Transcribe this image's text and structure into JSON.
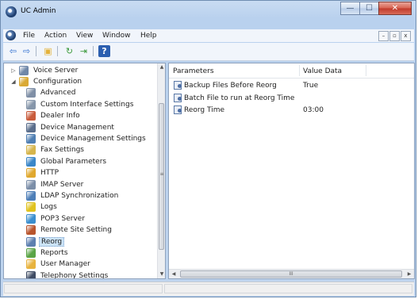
{
  "window": {
    "title": "UC Admin"
  },
  "menu": [
    "File",
    "Action",
    "View",
    "Window",
    "Help"
  ],
  "caption_buttons": {
    "minimize": "—",
    "maximize": "☐",
    "close": "✕"
  },
  "mdi_buttons": {
    "minimize": "–",
    "restore": "▫",
    "close": "x"
  },
  "toolbar": [
    {
      "name": "back-icon",
      "glyph": "⇦",
      "color": "#2f6fd0"
    },
    {
      "name": "forward-icon",
      "glyph": "⇨",
      "color": "#2f6fd0"
    },
    {
      "name": "up-folder-icon",
      "glyph": "▣",
      "color": "#e4b23a"
    },
    {
      "name": "refresh-icon",
      "glyph": "↻",
      "color": "#3c9a3c"
    },
    {
      "name": "export-list-icon",
      "glyph": "⇥",
      "color": "#3c9a3c"
    },
    {
      "name": "help-icon",
      "glyph": "?",
      "color": "#ffffff"
    }
  ],
  "tree": [
    {
      "label": "Voice Server",
      "level": 0,
      "expander": "▷",
      "icon": "server-icon",
      "color": "#6f87a8"
    },
    {
      "label": "Configuration",
      "level": 0,
      "expander": "◢",
      "icon": "configuration-icon",
      "color": "#d9a935"
    },
    {
      "label": "Advanced",
      "level": 1,
      "icon": "advanced-icon",
      "color": "#7f8fa6"
    },
    {
      "label": "Custom Interface Settings",
      "level": 1,
      "icon": "custom-interface-icon",
      "color": "#8696aa"
    },
    {
      "label": "Dealer Info",
      "level": 1,
      "icon": "dealer-info-icon",
      "color": "#c95c3c"
    },
    {
      "label": "Device Management",
      "level": 1,
      "icon": "device-management-icon",
      "color": "#5a6e8c"
    },
    {
      "label": "Device Management Settings",
      "level": 1,
      "icon": "device-settings-icon",
      "color": "#4f7fb3"
    },
    {
      "label": "Fax Settings",
      "level": 1,
      "icon": "fax-icon",
      "color": "#d6b54c"
    },
    {
      "label": "Global Parameters",
      "level": 1,
      "icon": "globe-icon",
      "color": "#3a86c8"
    },
    {
      "label": "HTTP",
      "level": 1,
      "icon": "http-icon",
      "color": "#e0a82e"
    },
    {
      "label": "IMAP Server",
      "level": 1,
      "icon": "imap-icon",
      "color": "#7b8ea8"
    },
    {
      "label": "LDAP Synchronization",
      "level": 1,
      "icon": "ldap-icon",
      "color": "#4e7fb8"
    },
    {
      "label": "Logs",
      "level": 1,
      "icon": "logs-icon",
      "color": "#e0c21e"
    },
    {
      "label": "POP3 Server",
      "level": 1,
      "icon": "pop3-icon",
      "color": "#3b8fcf"
    },
    {
      "label": "Remote Site Setting",
      "level": 1,
      "icon": "remote-site-icon",
      "color": "#b9552d"
    },
    {
      "label": "Reorg",
      "level": 1,
      "icon": "reorg-icon",
      "color": "#5d7fb0",
      "selected": true
    },
    {
      "label": "Reports",
      "level": 1,
      "icon": "reports-icon",
      "color": "#5aa446"
    },
    {
      "label": "User Manager",
      "level": 1,
      "icon": "user-manager-icon",
      "color": "#e8b33e"
    },
    {
      "label": "Telephony Settings",
      "level": 1,
      "icon": "telephony-icon",
      "color": "#3e4b63"
    }
  ],
  "list": {
    "columns": [
      "Parameters",
      "Value Data"
    ],
    "rows": [
      {
        "parameter": "Backup Files Before Reorg",
        "value": "True"
      },
      {
        "parameter": "Batch File to run at Reorg Time",
        "value": ""
      },
      {
        "parameter": "Reorg Time",
        "value": "03:00"
      }
    ]
  },
  "scroll": {
    "up": "▲",
    "down": "▼",
    "left": "◀",
    "right": "▶",
    "grip": "≡",
    "hgrip": "III"
  }
}
